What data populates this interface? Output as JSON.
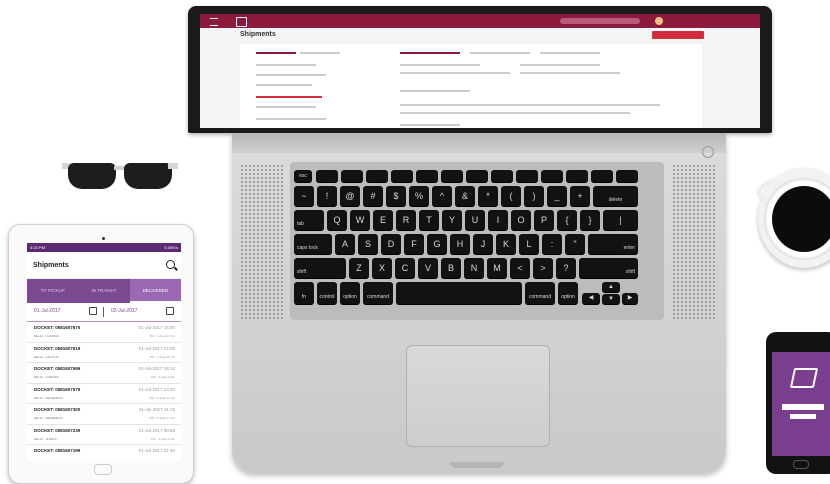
{
  "laptop": {
    "page_title": "Shipments",
    "user_name": "",
    "action_button": ""
  },
  "keyboard": {
    "row_fn": [
      "esc",
      "",
      "",
      "",
      "",
      "",
      "",
      "",
      "",
      "",
      "",
      "",
      "",
      ""
    ],
    "row_num": [
      "~",
      "!",
      "@",
      "#",
      "$",
      "%",
      "^",
      "&",
      "*",
      "(",
      ")",
      "_",
      "+",
      "delete"
    ],
    "row_q": [
      "tab",
      "Q",
      "W",
      "E",
      "R",
      "T",
      "Y",
      "U",
      "I",
      "O",
      "P",
      "{",
      "}",
      "|"
    ],
    "row_a": [
      "caps lock",
      "A",
      "S",
      "D",
      "F",
      "G",
      "H",
      "J",
      "K",
      "L",
      ":",
      "\"",
      "enter"
    ],
    "row_z": [
      "shift",
      "Z",
      "X",
      "C",
      "V",
      "B",
      "N",
      "M",
      "<",
      ">",
      "?",
      "shift"
    ],
    "row_bottom": [
      "fn",
      "control",
      "option",
      "command",
      "",
      "command",
      "option"
    ]
  },
  "tablet": {
    "status_time": "4:23 PM",
    "status_right": "5.00K/s",
    "title": "Shipments",
    "tabs": [
      {
        "label": "TO PICKUP",
        "active": false
      },
      {
        "label": "IN TRANSIT",
        "active": false
      },
      {
        "label": "DELIVERED",
        "active": true
      }
    ],
    "date_from": "01-Jul-2017",
    "date_to": "02-Jul-2017",
    "rows": [
      {
        "docket": "DOCKET: 0581607675",
        "route": "DELHI - CHENNAI",
        "time": "01-Jul-2017 15:00",
        "tat": "TAT - 1 days 21 hrs"
      },
      {
        "docket": "DOCKET: 0581607619",
        "route": "DELHI - CALICUT",
        "time": "01-Jul-2017 14:00",
        "tat": "TAT - 1 days 20 hrs"
      },
      {
        "docket": "DOCKET: 0581607596",
        "route": "DELHI - CHENNAI",
        "time": "01-Jul-2017 18:10",
        "tat": "TAT - 2 days 0 hrs"
      },
      {
        "docket": "DOCKET: 0581607579",
        "route": "DELHI - DEHRADUN",
        "time": "01-Jul-2017 13:20",
        "tat": "TAT - 1 days 19 hrs"
      },
      {
        "docket": "DOCKET: 0581607300",
        "route": "DELHI - DEHRADUN",
        "time": "01-Jul-2017 11:15",
        "tat": "TAT - 1 days 17 hrs"
      },
      {
        "docket": "DOCKET: 0581607239",
        "route": "DELHI - SHIMLA",
        "time": "01-Jul-2017 00:55",
        "tat": "TAT - 1 days 6 hrs"
      },
      {
        "docket": "DOCKET: 0581607199",
        "route": "",
        "time": "01-Jul-2017 21:40",
        "tat": ""
      }
    ]
  },
  "phone": {
    "login_text": "",
    "button_text": ""
  }
}
